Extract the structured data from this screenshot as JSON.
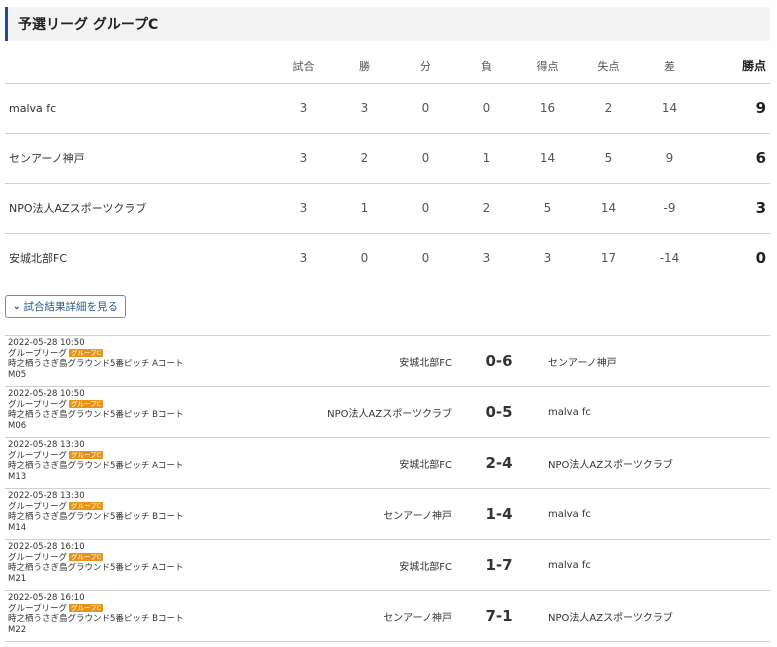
{
  "title": "予選リーグ グループC",
  "standings": {
    "headers": [
      "試合",
      "勝",
      "分",
      "負",
      "得点",
      "失点",
      "差",
      "勝点"
    ],
    "rows": [
      {
        "team": "malva fc",
        "played": "3",
        "won": "3",
        "drawn": "0",
        "lost": "0",
        "gf": "16",
        "ga": "2",
        "gd": "14",
        "pts": "9"
      },
      {
        "team": "センアーノ神戸",
        "played": "3",
        "won": "2",
        "drawn": "0",
        "lost": "1",
        "gf": "14",
        "ga": "5",
        "gd": "9",
        "pts": "6"
      },
      {
        "team": "NPO法人AZスポーツクラブ",
        "played": "3",
        "won": "1",
        "drawn": "0",
        "lost": "2",
        "gf": "5",
        "ga": "14",
        "gd": "-9",
        "pts": "3"
      },
      {
        "team": "安城北部FC",
        "played": "3",
        "won": "0",
        "drawn": "0",
        "lost": "3",
        "gf": "3",
        "ga": "17",
        "gd": "-14",
        "pts": "0"
      }
    ]
  },
  "detail_button": {
    "label": "試合結果詳細を見る",
    "icon": "chevron-down-icon"
  },
  "matches": [
    {
      "datetime": "2022-05-28 10:50",
      "stage": "グループリーグ",
      "badge": "グループC",
      "venue": "時之栖うさぎ島グラウンド5番ピッチ Aコート",
      "code": "M05",
      "home": "安城北部FC",
      "score": "0-6",
      "away": "センアーノ神戸"
    },
    {
      "datetime": "2022-05-28 10:50",
      "stage": "グループリーグ",
      "badge": "グループC",
      "venue": "時之栖うさぎ島グラウンド5番ピッチ Bコート",
      "code": "M06",
      "home": "NPO法人AZスポーツクラブ",
      "score": "0-5",
      "away": "malva fc"
    },
    {
      "datetime": "2022-05-28 13:30",
      "stage": "グループリーグ",
      "badge": "グループC",
      "venue": "時之栖うさぎ島グラウンド5番ピッチ Aコート",
      "code": "M13",
      "home": "安城北部FC",
      "score": "2-4",
      "away": "NPO法人AZスポーツクラブ"
    },
    {
      "datetime": "2022-05-28 13:30",
      "stage": "グループリーグ",
      "badge": "グループC",
      "venue": "時之栖うさぎ島グラウンド5番ピッチ Bコート",
      "code": "M14",
      "home": "センアーノ神戸",
      "score": "1-4",
      "away": "malva fc"
    },
    {
      "datetime": "2022-05-28 16:10",
      "stage": "グループリーグ",
      "badge": "グループC",
      "venue": "時之栖うさぎ島グラウンド5番ピッチ Aコート",
      "code": "M21",
      "home": "安城北部FC",
      "score": "1-7",
      "away": "malva fc"
    },
    {
      "datetime": "2022-05-28 16:10",
      "stage": "グループリーグ",
      "badge": "グループC",
      "venue": "時之栖うさぎ島グラウンド5番ピッチ Bコート",
      "code": "M22",
      "home": "センアーノ神戸",
      "score": "7-1",
      "away": "NPO法人AZスポーツクラブ"
    }
  ],
  "colors": {
    "accent": "#1f4e8c",
    "badge": "#e8941a",
    "button_border": "#6a8fb5",
    "button_text": "#2d5c8a"
  }
}
